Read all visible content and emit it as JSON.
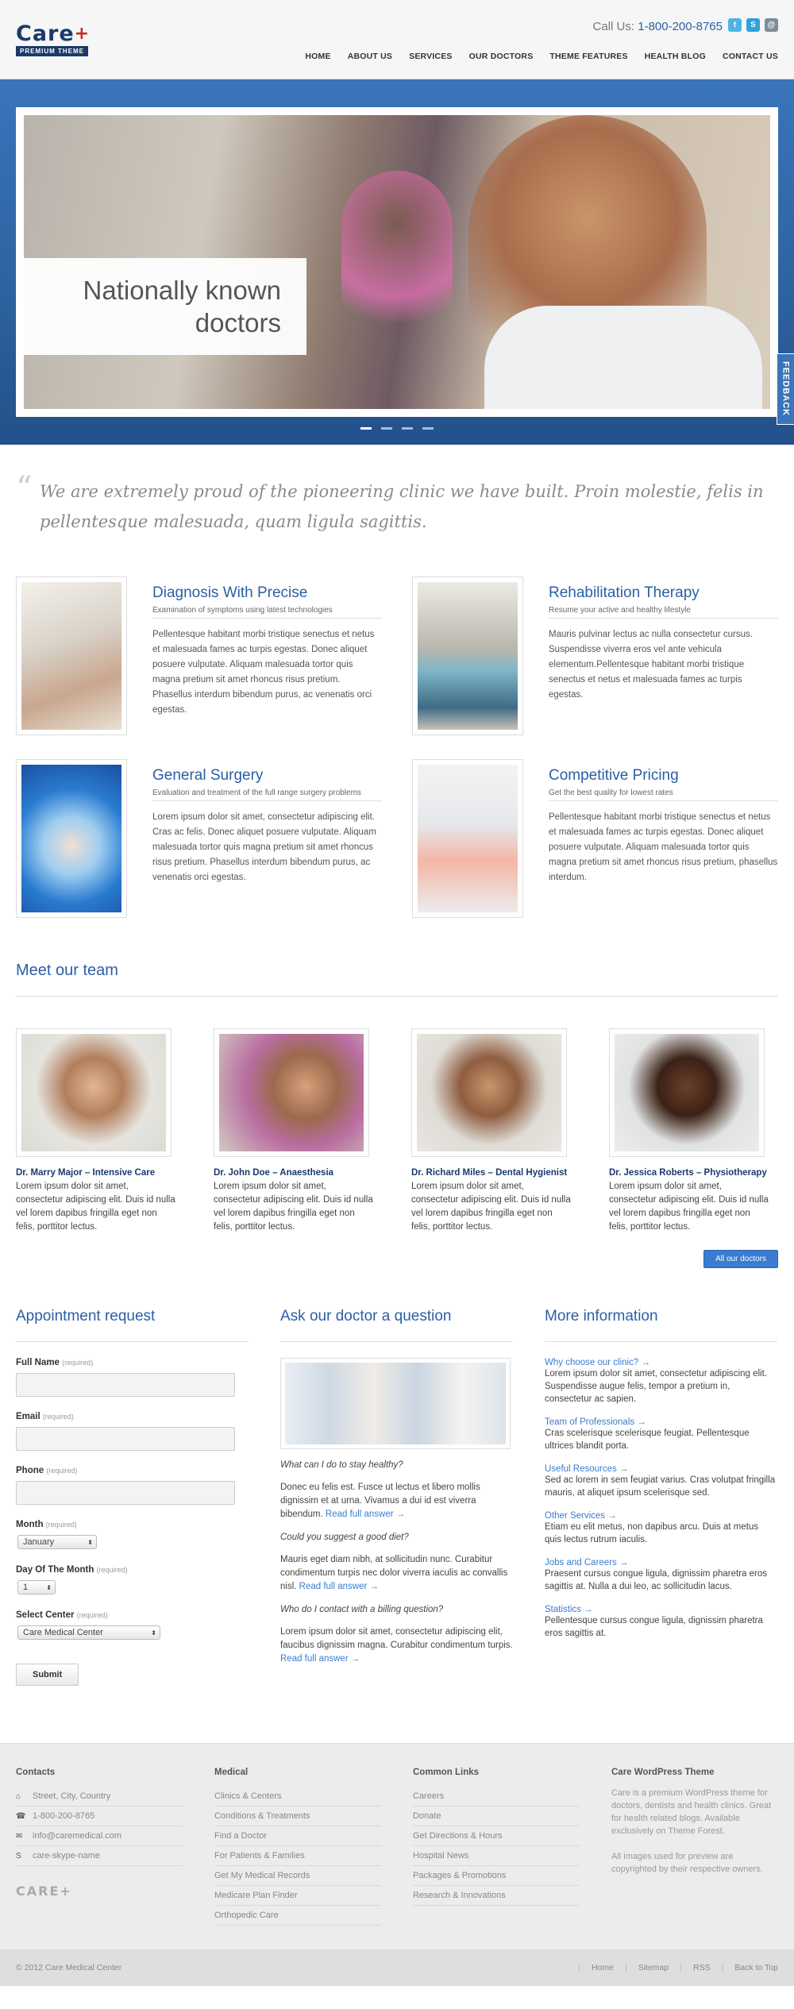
{
  "header": {
    "logo_main": "Care",
    "logo_plus": "+",
    "logo_sub": "PREMIUM THEME",
    "call_label": "Call Us:",
    "call_number": "1-800-200-8765",
    "nav": [
      "HOME",
      "ABOUT US",
      "SERVICES",
      "OUR DOCTORS",
      "THEME FEATURES",
      "HEALTH BLOG",
      "CONTACT US"
    ]
  },
  "hero": {
    "caption": "Nationally known doctors",
    "feedback": "FEEDBACK",
    "slides": 4,
    "active_slide": 0
  },
  "quote": "We are extremely proud of the pioneering clinic we have built. Proin molestie, felis in pellentesque malesuada, quam ligula sagittis.",
  "services": [
    {
      "title": "Diagnosis With Precise",
      "subtitle": "Examination of symptoms using latest technologies",
      "text": "Pellentesque habitant morbi tristique senectus et netus et malesuada fames ac turpis egestas. Donec aliquet posuere vulputate. Aliquam malesuada tortor quis magna pretium sit amet rhoncus risus pretium. Phasellus interdum bibendum purus, ac venenatis orci egestas."
    },
    {
      "title": "Rehabilitation Therapy",
      "subtitle": "Resume your active and healthy lifestyle",
      "text": "Mauris pulvinar lectus ac nulla consectetur cursus. Suspendisse viverra eros vel ante vehicula elementum.Pellentesque habitant morbi tristique senectus et netus et malesuada fames ac turpis egestas."
    },
    {
      "title": "General Surgery",
      "subtitle": "Evaluation and treatment of the full range surgery problems",
      "text": "Lorem ipsum dolor sit amet, consectetur adipiscing elit. Cras ac felis. Donec aliquet posuere vulputate. Aliquam malesuada tortor quis magna pretium sit amet rhoncus risus pretium. Phasellus interdum bibendum purus, ac venenatis orci egestas."
    },
    {
      "title": "Competitive Pricing",
      "subtitle": "Get the best quality for lowest rates",
      "text": "Pellentesque habitant morbi tristique senectus et netus et malesuada fames ac turpis egestas. Donec aliquet posuere vulputate. Aliquam malesuada tortor quis magna pretium sit amet rhoncus risus pretium, phasellus interdum."
    }
  ],
  "team": {
    "title": "Meet our team",
    "members": [
      {
        "name": "Dr. Marry Major – Intensive Care",
        "text": "Lorem ipsum dolor sit amet, consectetur adipiscing elit. Duis id nulla vel lorem dapibus fringilla eget non felis, porttitor lectus."
      },
      {
        "name": "Dr. John Doe – Anaesthesia",
        "text": "Lorem ipsum dolor sit amet, consectetur adipiscing elit. Duis id nulla vel lorem dapibus fringilla eget non felis, porttitor lectus."
      },
      {
        "name": "Dr. Richard Miles – Dental Hygienist",
        "text": "Lorem ipsum dolor sit amet, consectetur adipiscing elit. Duis id nulla vel lorem dapibus fringilla eget non felis, porttitor lectus."
      },
      {
        "name": "Dr. Jessica Roberts – Physiotherapy",
        "text": "Lorem ipsum dolor sit amet, consectetur adipiscing elit. Duis id nulla vel lorem dapibus fringilla eget non felis, porttitor lectus."
      }
    ],
    "all_button": "All our doctors"
  },
  "appointment": {
    "title": "Appointment request",
    "required": "(required)",
    "full_name": "Full Name",
    "email": "Email",
    "phone": "Phone",
    "month": "Month",
    "month_value": "January",
    "day": "Day Of The Month",
    "day_value": "1",
    "center": "Select Center",
    "center_value": "Care Medical Center",
    "submit": "Submit"
  },
  "ask": {
    "title": "Ask our doctor a question",
    "read_more": "Read full answer",
    "faqs": [
      {
        "q": "What can I do to stay healthy?",
        "a": "Donec eu felis est. Fusce ut lectus et libero mollis dignissim et at urna. Vivamus a dui id est viverra bibendum."
      },
      {
        "q": "Could you suggest a good diet?",
        "a": "Mauris eget diam nibh, at sollicitudin nunc. Curabitur condimentum turpis nec dolor viverra iaculis ac convallis nisl."
      },
      {
        "q": "Who do I contact with a billing question?",
        "a": "Lorem ipsum dolor sit amet, consectetur adipiscing elit, faucibus dignissim magna. Curabitur condimentum turpis."
      }
    ]
  },
  "info": {
    "title": "More information",
    "items": [
      {
        "title": "Why choose our clinic?",
        "text": "Lorem ipsum dolor sit amet, consectetur adipiscing elit. Suspendisse augue felis, tempor a pretium in, consectetur ac sapien."
      },
      {
        "title": "Team of Professionals",
        "text": "Cras scelerisque scelerisque feugiat. Pellentesque ultrices blandit porta."
      },
      {
        "title": "Useful Resources",
        "text": "Sed ac lorem in sem feugiat varius. Cras volutpat fringilla mauris, at aliquet ipsum scelerisque sed."
      },
      {
        "title": "Other Services",
        "text": "Etiam eu elit metus, non dapibus arcu. Duis at metus quis lectus rutrum iaculis."
      },
      {
        "title": "Jobs and Careers",
        "text": "Praesent cursus congue ligula, dignissim pharetra eros sagittis at. Nulla a dui leo, ac sollicitudin lacus."
      },
      {
        "title": "Statistics",
        "text": "Pellentesque cursus congue ligula, dignissim pharetra eros sagittis at."
      }
    ]
  },
  "footer": {
    "contacts_title": "Contacts",
    "contacts": [
      "Street, City, Country",
      "1-800-200-8765",
      "info@caremedical.com",
      "care-skype-name"
    ],
    "medical_title": "Medical",
    "medical": [
      "Clinics & Centers",
      "Conditions & Treatments",
      "Find a Doctor",
      "For Patients & Families",
      "Get My Medical Records",
      "Medicare Plan Finder",
      "Orthopedic Care"
    ],
    "links_title": "Common Links",
    "links": [
      "Careers",
      "Donate",
      "Get Directions & Hours",
      "Hospital News",
      "Packages & Promotions",
      "Research & Innovations"
    ],
    "theme_title": "Care WordPress Theme",
    "theme_text1": "Care is a premium WordPress theme for doctors, dentists and health clinics. Great for health related blogs. Available exclusively on Theme Forest.",
    "theme_text2": "All images used for preview are copyrighted by their respective owners.",
    "logo": "CARE+",
    "copyright": "© 2012 Care Medical Center",
    "bottom_links": [
      "Home",
      "Sitemap",
      "RSS",
      "Back to Top"
    ]
  }
}
